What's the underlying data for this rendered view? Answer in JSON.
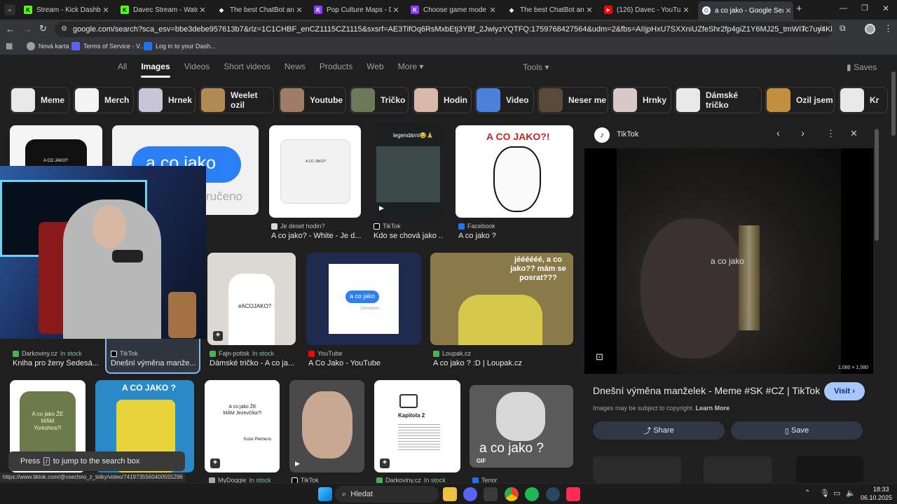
{
  "browser": {
    "tabs": [
      {
        "title": "Stream - Kick Dashboard",
        "fav_color": "#53fc18",
        "fav_text": "K"
      },
      {
        "title": "Davec Stream - Watch Live",
        "fav_color": "#53fc18",
        "fav_text": "K"
      },
      {
        "title": "The best ChatBot and Wi",
        "fav_color": "#ffffff",
        "fav_text": "◆"
      },
      {
        "title": "Pop Culture Maps - Detail",
        "fav_color": "#8c3bff",
        "fav_text": "K"
      },
      {
        "title": "Choose game mode - Kal",
        "fav_color": "#8c3bff",
        "fav_text": "K"
      },
      {
        "title": "The best ChatBot and Wi",
        "fav_color": "#ffffff",
        "fav_text": "◆"
      },
      {
        "title": "(126) Davec - YouTube",
        "fav_color": "#ff0000",
        "fav_text": "▶"
      },
      {
        "title": "a co jako - Google Search",
        "fav_color": "#4285f4",
        "fav_text": "G"
      }
    ],
    "new_tab": "+",
    "url": "google.com/search?sca_esv=bbe3debe957613b7&rlz=1C1CHBF_enCZ1115CZ1115&sxsrf=AE3TifOq6RsMxbEtj3YBf_2JwiyzYQTFQ:1759768427564&udm=2&fbs=AIIjpHxU7SXXniUZfeShr2fp4giZ1Y6MJ25_tmWITc7uy4KleoJTKjrFjVxydQWqI2NcOhYPURE...",
    "bookmarks": [
      {
        "label": "Nová karta",
        "color": "#9aa0a6"
      },
      {
        "label": "Terms of Service - V...",
        "color": "#5865f2"
      },
      {
        "label": "Log in to your Dash...",
        "color": "#1a73e8"
      }
    ]
  },
  "search": {
    "nav_tabs": [
      "All",
      "Images",
      "Videos",
      "Short videos",
      "News",
      "Products",
      "Web",
      "More"
    ],
    "selected_tab": "Images",
    "tools": "Tools",
    "saves": "Saves",
    "chips": [
      {
        "label": "Meme",
        "color": "#e8e8e8"
      },
      {
        "label": "Merch",
        "color": "#f4f4f4"
      },
      {
        "label": "Hrnek",
        "color": "#c8c4d8"
      },
      {
        "label": "Weelet ozil",
        "color": "#b08a50"
      },
      {
        "label": "Youtube",
        "color": "#a07c68"
      },
      {
        "label": "Tričko",
        "color": "#6a7a5a"
      },
      {
        "label": "Hodin",
        "color": "#d8b8a8"
      },
      {
        "label": "Video",
        "color": "#4a80d8"
      },
      {
        "label": "Neser me",
        "color": "#5a4a3a"
      },
      {
        "label": "Hrnky",
        "color": "#d8c8c8"
      },
      {
        "label": "Dámské tričko",
        "color": "#e8e8e8"
      },
      {
        "label": "Ozil jsem",
        "color": "#c09040"
      },
      {
        "label": "Kr",
        "color": "#e8e8e8"
      }
    ]
  },
  "results": {
    "row1": [
      {
        "source": "Je deset hodin?",
        "caption": "A co jako? - White - Je d...",
        "stock": ""
      },
      {
        "source": "TikTok",
        "caption": "Kdo se chová jako ...",
        "stock": ""
      },
      {
        "source": "Facebook",
        "caption": "A co jako ?",
        "stock": ""
      }
    ],
    "row2": [
      {
        "source": "Darkoviny.cz",
        "stock": "In stock",
        "caption": "Kniha pro ženy Šedesá..."
      },
      {
        "source": "TikTok",
        "stock": "",
        "caption": "Dnešní výměna manže..."
      },
      {
        "source": "Fajn-potisk",
        "stock": "In stock",
        "caption": "Dámské tričko - A co ja..."
      },
      {
        "source": "YouTube",
        "stock": "",
        "caption": "A Co Jako - YouTube"
      },
      {
        "source": "Loupak.cz",
        "stock": "",
        "caption": "A co jako ? :D | Loupak.cz"
      }
    ],
    "row3_sources": [
      {
        "source": "MyDoggie",
        "stock": "In stock"
      },
      {
        "source": "TikTok",
        "stock": ""
      },
      {
        "source": "Darkoviny.cz",
        "stock": "In stock"
      },
      {
        "source": "Tenor",
        "stock": ""
      }
    ],
    "texts": {
      "tshirt_small": "A CO JAKO?",
      "bubble_large": "a co jako",
      "bubble_sub": "ručeno",
      "tiktok_overlay": "legendární😂🙏",
      "meme_title": "A CO JAKO?!",
      "shirt2": "#ACOJAKO?",
      "bubble_small": "a co jako",
      "bubble_small_sub": "Doručeno",
      "yellow_text": "jéééééé, a co jako?? mám se posrat???",
      "green_shirt": "A co jako ŽE MÁM Yorkshira?!",
      "sponge": "A CO JAKO ?",
      "white_shirt": "A co jako ŽE MÁM Jezevčíka?!",
      "white_shirt_arrow": "Kuše Plemeno",
      "book": "Kapitola 2",
      "goat": "a co jako ?",
      "gif": "GIF"
    }
  },
  "panel": {
    "source": "TikTok",
    "overlay_text": "a co jako",
    "dimensions": "1,080 × 1,080",
    "title": "Dnešní výměna manželek - Meme #SK #CZ | TikTok",
    "visit": "Visit",
    "copyright": "Images may be subject to copyright.",
    "learn_more": "Learn More",
    "share": "Share",
    "save": "Save"
  },
  "overlay": {
    "toast_pre": "Press",
    "toast_key": "/",
    "toast_post": "to jump to the search box",
    "status_url": "https://www.tiktok.com/@vsechno_z_telky/video/7419735560400555296"
  },
  "taskbar": {
    "search": "Hledat",
    "time": "18:33",
    "date": "06.10.2025"
  },
  "colors": {
    "accent": "#a8c7fa",
    "in_stock": "#81c995",
    "page_bg": "#1f1f1f"
  }
}
